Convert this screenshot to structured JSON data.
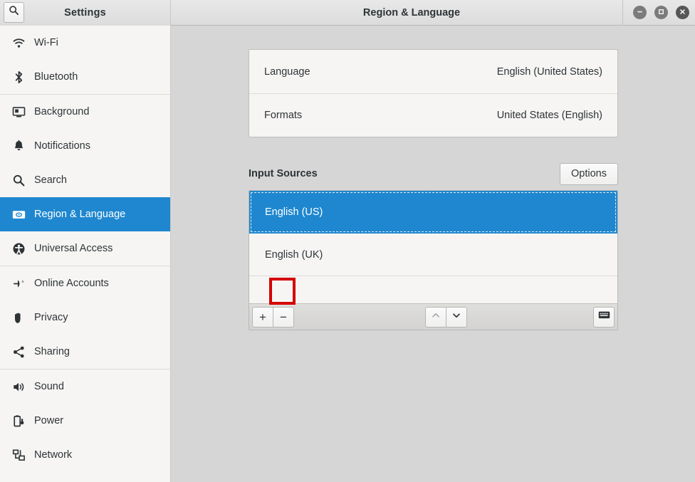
{
  "window": {
    "app_title": "Settings",
    "page_title": "Region & Language",
    "controls": {
      "minimize": "minimize",
      "maximize": "maximize",
      "close": "close"
    },
    "search_icon": "search-icon"
  },
  "sidebar": {
    "items": [
      {
        "label": "Wi-Fi",
        "icon": "wifi-icon",
        "active": false,
        "sep_after": false
      },
      {
        "label": "Bluetooth",
        "icon": "bluetooth-icon",
        "active": false,
        "sep_after": true
      },
      {
        "label": "Background",
        "icon": "background-icon",
        "active": false,
        "sep_after": false
      },
      {
        "label": "Notifications",
        "icon": "bell-icon",
        "active": false,
        "sep_after": false
      },
      {
        "label": "Search",
        "icon": "magnifier-icon",
        "active": false,
        "sep_after": false
      },
      {
        "label": "Region & Language",
        "icon": "region-language-icon",
        "active": true,
        "sep_after": false
      },
      {
        "label": "Universal Access",
        "icon": "accessibility-icon",
        "active": false,
        "sep_after": true
      },
      {
        "label": "Online Accounts",
        "icon": "online-accounts-icon",
        "active": false,
        "sep_after": false
      },
      {
        "label": "Privacy",
        "icon": "hand-icon",
        "active": false,
        "sep_after": false
      },
      {
        "label": "Sharing",
        "icon": "share-icon",
        "active": false,
        "sep_after": true
      },
      {
        "label": "Sound",
        "icon": "speaker-icon",
        "active": false,
        "sep_after": false
      },
      {
        "label": "Power",
        "icon": "battery-icon",
        "active": false,
        "sep_after": false
      },
      {
        "label": "Network",
        "icon": "network-icon",
        "active": false,
        "sep_after": false
      }
    ]
  },
  "main": {
    "language_card": {
      "rows": [
        {
          "label": "Language",
          "value": "English (United States)"
        },
        {
          "label": "Formats",
          "value": "United States (English)"
        }
      ]
    },
    "input_sources": {
      "section_label": "Input Sources",
      "options_button": "Options",
      "sources": [
        {
          "label": "English (US)",
          "selected": true
        },
        {
          "label": "English (UK)",
          "selected": false
        }
      ],
      "toolbar": {
        "add_label": "+",
        "remove_label": "−",
        "move_up_icon": "chevron-up-icon",
        "move_down_icon": "chevron-down-icon",
        "keyboard_preview_icon": "keyboard-icon"
      }
    }
  },
  "annotation": {
    "target": "remove-input-source-button",
    "color": "#d40000"
  },
  "colors": {
    "accent_blue": "#1f87cf",
    "sidebar_bg": "#f6f5f4",
    "content_bg": "#d6d6d6",
    "text": "#2e3436",
    "annotation_red": "#d40000"
  }
}
